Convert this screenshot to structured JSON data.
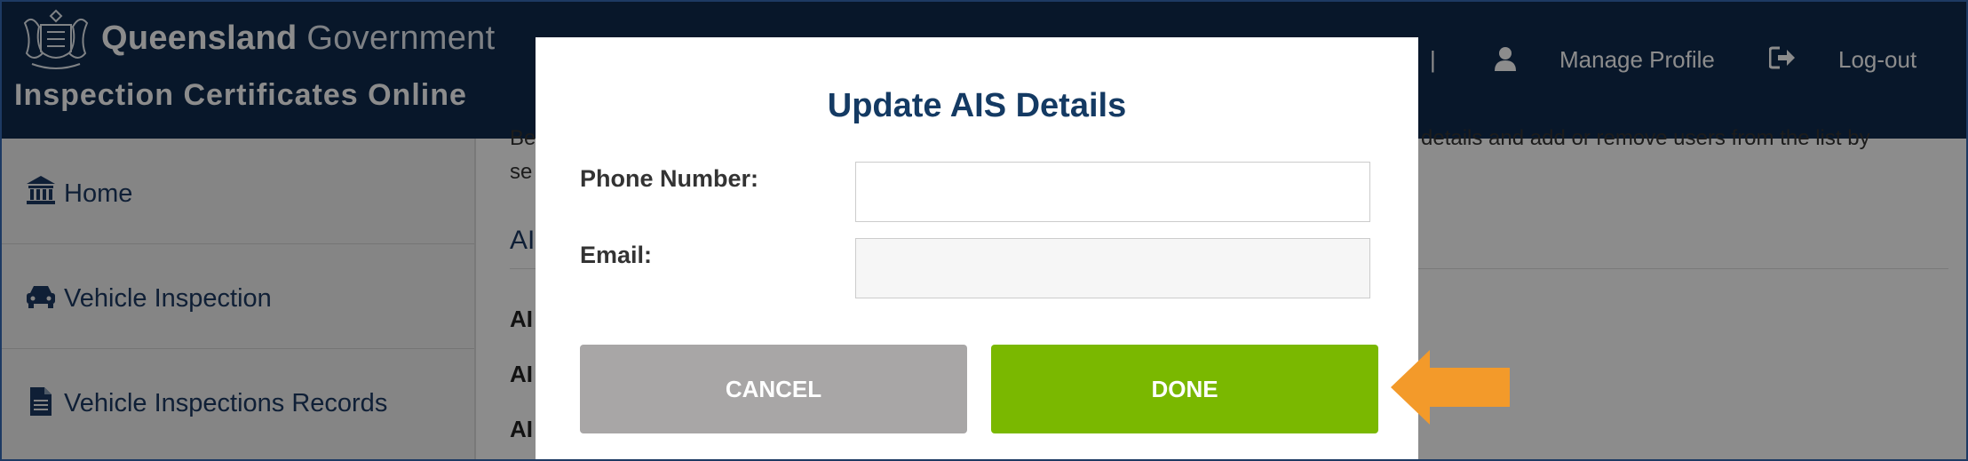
{
  "header": {
    "brand_bold": "Queensland",
    "brand_light": "Government",
    "app_title": "Inspection Certificates Online",
    "nav_separator": "|",
    "manage_profile": "Manage Profile",
    "logout": "Log-out"
  },
  "sidebar": {
    "items": [
      {
        "label": "Home",
        "icon": "bank-icon"
      },
      {
        "label": "Vehicle Inspection",
        "icon": "car-icon"
      },
      {
        "label": "Vehicle Inspections Records",
        "icon": "document-icon"
      }
    ]
  },
  "main": {
    "para_left_1": "Be",
    "para_left_2": "se",
    "para_right": "details and add or remove users from the list by",
    "section_head": "AI",
    "row_labels": [
      "AI",
      "AI",
      "AI"
    ]
  },
  "modal": {
    "title": "Update AIS Details",
    "phone_label": "Phone Number:",
    "phone_value": "",
    "email_label": "Email:",
    "email_value": "",
    "cancel_label": "CANCEL",
    "done_label": "DONE"
  },
  "colors": {
    "header_bg": "#0f2a4e",
    "done_green": "#7ab800",
    "cancel_grey": "#a8a6a6",
    "title_blue": "#143a63",
    "callout_orange": "#f39a2a"
  },
  "callout": {
    "icon": "arrow-left-icon"
  }
}
